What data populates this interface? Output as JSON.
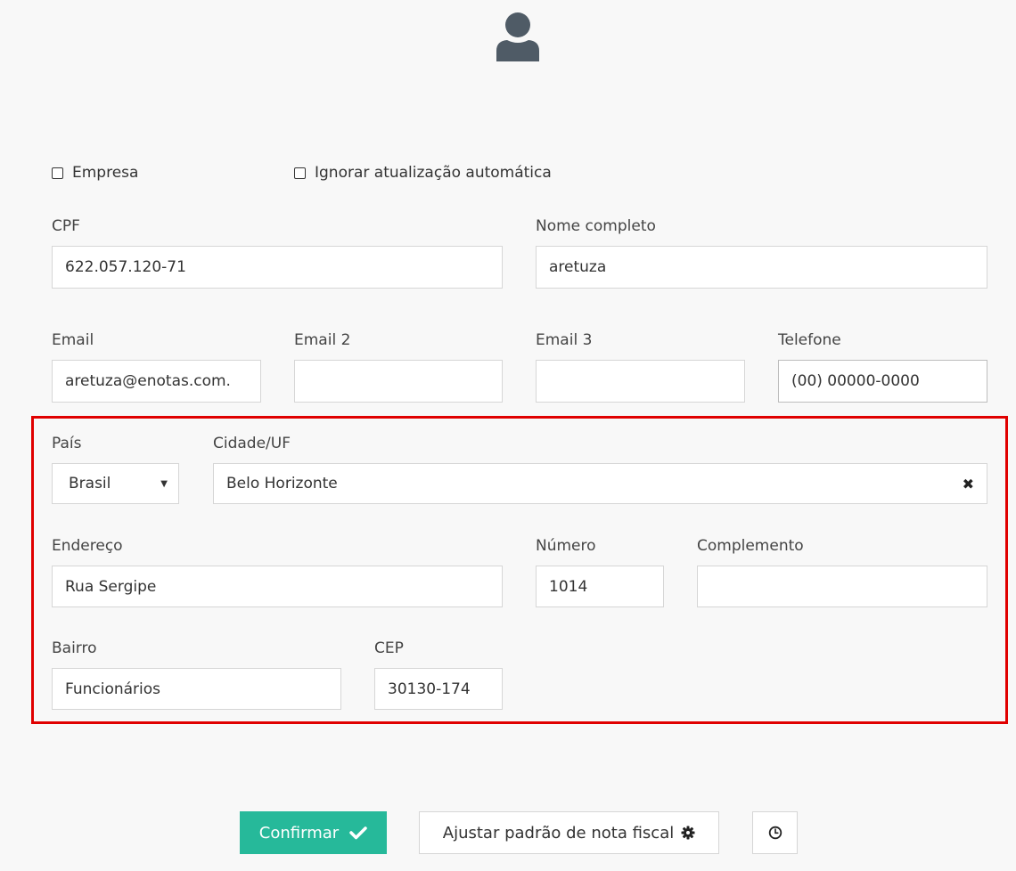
{
  "header": {
    "icon": "user-icon",
    "icon_color": "#4f5b66"
  },
  "options": {
    "empresa_label": "Empresa",
    "ignorar_label": "Ignorar atualização automática"
  },
  "fields": {
    "cpf": {
      "label": "CPF",
      "value": "622.057.120-71"
    },
    "nome": {
      "label": "Nome completo",
      "value": "aretuza"
    },
    "email": {
      "label": "Email",
      "value": "aretuza@enotas.com."
    },
    "email2": {
      "label": "Email 2",
      "value": ""
    },
    "email3": {
      "label": "Email 3",
      "value": ""
    },
    "telefone": {
      "label": "Telefone",
      "value": "(00) 00000-0000"
    },
    "pais": {
      "label": "País",
      "value": "Brasil"
    },
    "cidade": {
      "label": "Cidade/UF",
      "value": "Belo Horizonte"
    },
    "endereco": {
      "label": "Endereço",
      "value": "Rua Sergipe"
    },
    "numero": {
      "label": "Número",
      "value": "1014"
    },
    "complemento": {
      "label": "Complemento",
      "value": ""
    },
    "bairro": {
      "label": "Bairro",
      "value": "Funcionários"
    },
    "cep": {
      "label": "CEP",
      "value": "30130-174"
    }
  },
  "actions": {
    "confirm_label": "Confirmar",
    "adjust_label": "Ajustar padrão de nota fiscal",
    "confirm_color": "#26b99a",
    "highlight_color": "#e00000"
  }
}
